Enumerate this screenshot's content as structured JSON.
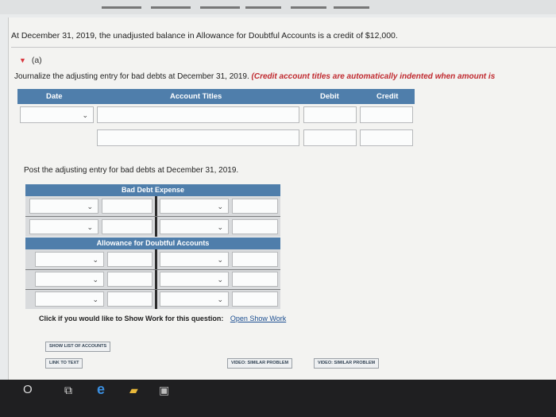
{
  "problem": {
    "statement": "At December 31, 2019, the unadjusted balance in Allowance for Doubtful Accounts is a credit of $12,000."
  },
  "part": {
    "label": "(a)",
    "instruction": "Journalize the adjusting entry for bad debts at December 31, 2019.",
    "note": "(Credit account titles are automatically indented when amount is"
  },
  "journal": {
    "headers": {
      "date": "Date",
      "account": "Account Titles",
      "debit": "Debit",
      "credit": "Credit"
    }
  },
  "posting": {
    "instruction": "Post the adjusting entry for bad debts at December 31, 2019.",
    "account1": "Bad Debt Expense",
    "account2": "Allowance for Doubtful Accounts"
  },
  "showwork": {
    "prompt": "Click if you would like to Show Work for this question:",
    "link": "Open Show Work"
  },
  "buttons": {
    "accounts": "SHOW LIST OF ACCOUNTS",
    "link_text": "LINK TO TEXT",
    "video1": "VIDEO: SIMILAR PROBLEM",
    "video2": "VIDEO: SIMILAR PROBLEM"
  },
  "icons": {
    "chevron": "⌄",
    "triangle": "▼",
    "start": "O",
    "taskview": "⧉",
    "edge": "e",
    "files": "▰",
    "store": "▣"
  },
  "colors": {
    "header_blue": "#4f7eab",
    "accent_red": "#c0292f"
  }
}
